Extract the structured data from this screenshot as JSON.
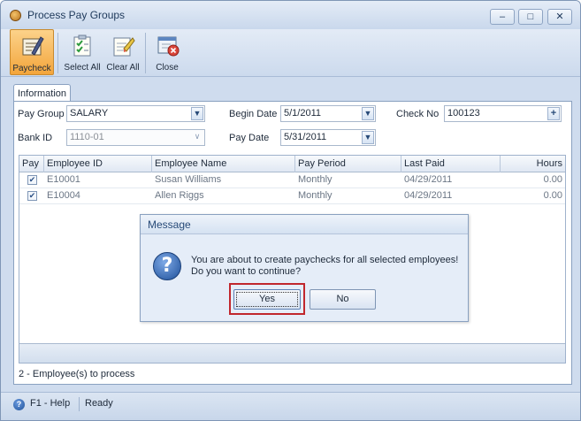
{
  "window": {
    "title": "Process Pay Groups"
  },
  "toolbar": {
    "paycheck": "Paycheck",
    "select_all": "Select All",
    "clear_all": "Clear All",
    "close": "Close"
  },
  "tabs": {
    "information": "Information"
  },
  "form": {
    "pay_group_label": "Pay Group",
    "pay_group_value": "SALARY",
    "bank_id_label": "Bank ID",
    "bank_id_value": "1110-01",
    "begin_date_label": "Begin Date",
    "begin_date_value": "5/1/2011",
    "pay_date_label": "Pay Date",
    "pay_date_value": "5/31/2011",
    "check_no_label": "Check No",
    "check_no_value": "100123"
  },
  "grid": {
    "columns": [
      "Pay",
      "Employee ID",
      "Employee Name",
      "Pay Period",
      "Last Paid",
      "Hours"
    ],
    "rows": [
      {
        "employee_id": "E10001",
        "employee_name": "Susan Williams",
        "pay_period": "Monthly",
        "last_paid": "04/29/2011",
        "hours": "0.00",
        "checked": true
      },
      {
        "employee_id": "E10004",
        "employee_name": "Allen Riggs",
        "pay_period": "Monthly",
        "last_paid": "04/29/2011",
        "hours": "0.00",
        "checked": true
      }
    ],
    "summary": "2 -  Employee(s) to process"
  },
  "dialog": {
    "title": "Message",
    "line1": "You are about to create paychecks for all selected employees!",
    "line2": "Do you want to continue?",
    "yes": "Yes",
    "no": "No"
  },
  "status": {
    "help": "F1 - Help",
    "state": "Ready"
  },
  "colors": {
    "window_bg": "#cfdcee",
    "active_toolbar": "#f3a53b",
    "highlight_box": "#c1272d"
  },
  "icons": {
    "app": "pay-group-app-icon",
    "paycheck": "paycheck-icon",
    "select_all": "select-all-checklist-icon",
    "clear_all": "clear-all-eraser-icon",
    "close": "close-window-icon",
    "help": "help-icon",
    "question": "question-icon"
  }
}
